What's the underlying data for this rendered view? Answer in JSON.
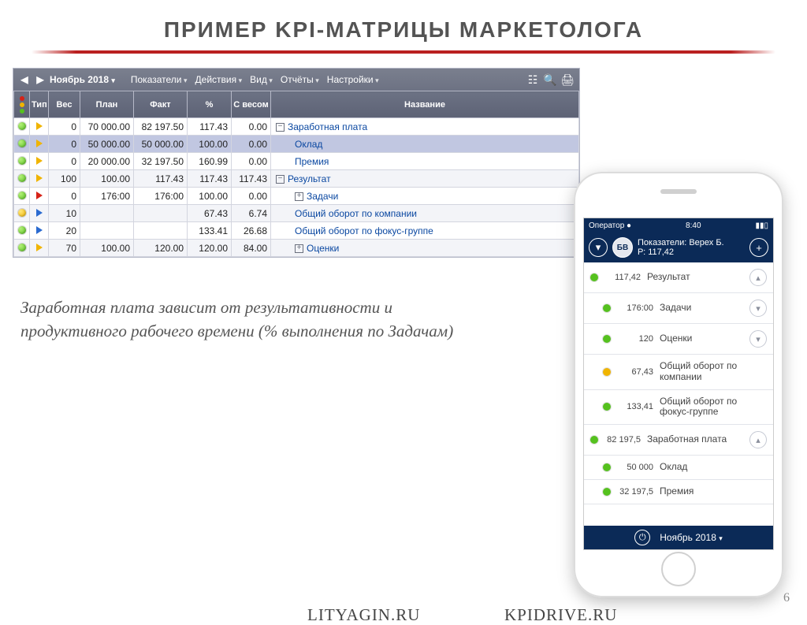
{
  "slide": {
    "title": "ПРИМЕР KPI-МАТРИЦЫ МАРКЕТОЛОГА",
    "caption": "Заработная плата зависит от результативности и продуктивного рабочего времени (% выполнения по Задачам)",
    "link1": "LITYAGIN.RU",
    "link2": "KPIDRIVE.RU",
    "page": "6"
  },
  "toolbar": {
    "month": "Ноябрь 2018",
    "menus": [
      "Показатели",
      "Действия",
      "Вид",
      "Отчёты",
      "Настройки"
    ]
  },
  "columns": {
    "status": "",
    "type": "Тип",
    "weight": "Вес",
    "plan": "План",
    "fact": "Факт",
    "percent": "%",
    "weighted": "С весом",
    "name": "Название"
  },
  "rows": [
    {
      "status": "green",
      "type": "yellow",
      "weight": "0",
      "plan": "70 000.00",
      "fact": "82 197.50",
      "percent": "117.43",
      "weighted": "0.00",
      "tree": "minus",
      "indent": 0,
      "name": "Заработная плата",
      "sel": false
    },
    {
      "status": "green",
      "type": "yellow",
      "weight": "0",
      "plan": "50 000.00",
      "fact": "50 000.00",
      "percent": "100.00",
      "weighted": "0.00",
      "tree": "",
      "indent": 1,
      "name": "Оклад",
      "sel": true
    },
    {
      "status": "green",
      "type": "yellow",
      "weight": "0",
      "plan": "20 000.00",
      "fact": "32 197.50",
      "percent": "160.99",
      "weighted": "0.00",
      "tree": "",
      "indent": 1,
      "name": "Премия",
      "sel": false
    },
    {
      "status": "green",
      "type": "yellow",
      "weight": "100",
      "plan": "100.00",
      "fact": "117.43",
      "percent": "117.43",
      "weighted": "117.43",
      "tree": "minus",
      "indent": 0,
      "name": "Результат",
      "sel": false
    },
    {
      "status": "green",
      "type": "red",
      "weight": "0",
      "plan": "176:00",
      "fact": "176:00",
      "percent": "100.00",
      "weighted": "0.00",
      "tree": "plus",
      "indent": 1,
      "name": "Задачи",
      "sel": false
    },
    {
      "status": "yellow",
      "type": "blue",
      "weight": "10",
      "plan": "",
      "fact": "",
      "percent": "67.43",
      "weighted": "6.74",
      "tree": "",
      "indent": 1,
      "name": "Общий оборот по компании",
      "sel": false
    },
    {
      "status": "green",
      "type": "blue",
      "weight": "20",
      "plan": "",
      "fact": "",
      "percent": "133.41",
      "weighted": "26.68",
      "tree": "",
      "indent": 1,
      "name": "Общий оборот по фокус-группе",
      "sel": false
    },
    {
      "status": "green",
      "type": "yellow",
      "weight": "70",
      "plan": "100.00",
      "fact": "120.00",
      "percent": "120.00",
      "weighted": "84.00",
      "tree": "plus",
      "indent": 1,
      "name": "Оценки",
      "sel": false
    }
  ],
  "phone": {
    "carrier": "Оператор",
    "time": "8:40",
    "avatar": "БВ",
    "title_line1": "Показатели: Верех Б.",
    "title_line2": "Р: 117,42",
    "month": "Ноябрь 2018",
    "items": [
      {
        "dot": "green",
        "val": "117,42",
        "name": "Результат",
        "chev": "up",
        "indent": false
      },
      {
        "dot": "green",
        "val": "176:00",
        "name": "Задачи",
        "chev": "down",
        "indent": true
      },
      {
        "dot": "green",
        "val": "120",
        "name": "Оценки",
        "chev": "down",
        "indent": true
      },
      {
        "dot": "yellow",
        "val": "67,43",
        "name": "Общий оборот по компании",
        "chev": "",
        "indent": true
      },
      {
        "dot": "green",
        "val": "133,41",
        "name": "Общий оборот по фокус-группе",
        "chev": "",
        "indent": true
      },
      {
        "dot": "green",
        "val": "82 197,5",
        "name": "Заработная плата",
        "chev": "up",
        "indent": false
      },
      {
        "dot": "green",
        "val": "50 000",
        "name": "Оклад",
        "chev": "",
        "indent": true
      },
      {
        "dot": "green",
        "val": "32 197,5",
        "name": "Премия",
        "chev": "",
        "indent": true
      }
    ]
  }
}
